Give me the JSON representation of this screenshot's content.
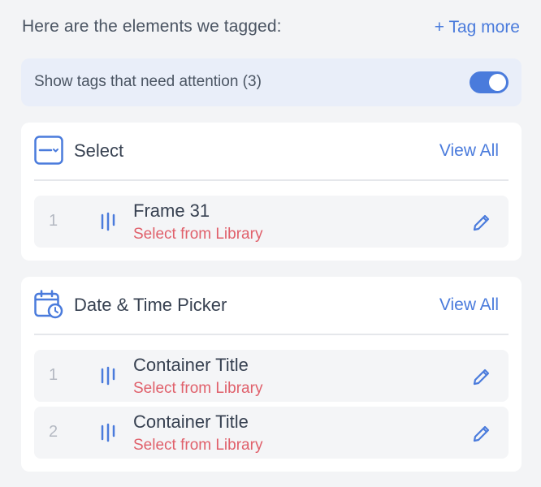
{
  "header": {
    "title": "Here are the elements we tagged:",
    "tag_more": "+ Tag more"
  },
  "attention": {
    "label": "Show tags that need attention (3)",
    "toggle_on": true
  },
  "sections": [
    {
      "title": "Select",
      "icon": "select-dropdown-icon",
      "view_all": "View All",
      "items": [
        {
          "index": "1",
          "name": "Frame 31",
          "action": "Select from Library"
        }
      ]
    },
    {
      "title": "Date & Time Picker",
      "icon": "calendar-clock-icon",
      "view_all": "View All",
      "items": [
        {
          "index": "1",
          "name": "Container Title",
          "action": "Select from Library"
        },
        {
          "index": "2",
          "name": "Container Title",
          "action": "Select from Library"
        }
      ]
    }
  ],
  "colors": {
    "accent": "#4a7bdc",
    "warning": "#e0606b",
    "background": "#f3f4f6"
  }
}
